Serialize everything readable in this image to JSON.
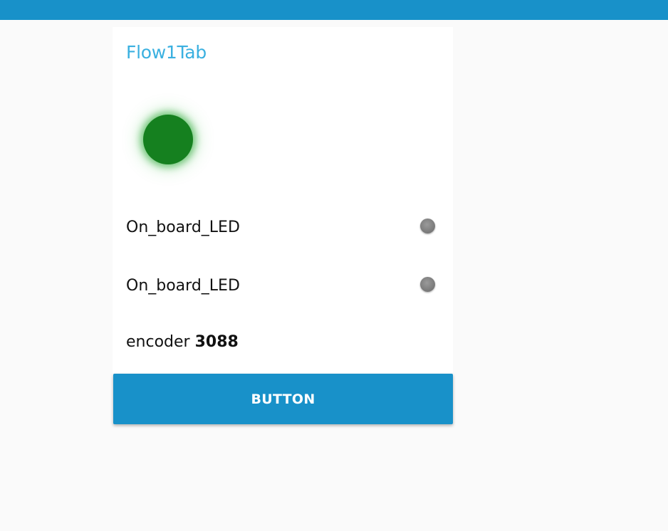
{
  "header": {
    "bar_color": "#1891c9"
  },
  "card": {
    "title": "Flow1Tab",
    "status_led": {
      "state": "on",
      "color": "#15801f"
    },
    "switches": [
      {
        "label": "On_board_LED",
        "state": "off",
        "color": "#7d7d7d"
      },
      {
        "label": "On_board_LED",
        "state": "off",
        "color": "#7d7d7d"
      }
    ],
    "encoder": {
      "label": "encoder",
      "value": "3088"
    }
  },
  "button": {
    "label": "BUTTON",
    "color": "#1891c9"
  }
}
